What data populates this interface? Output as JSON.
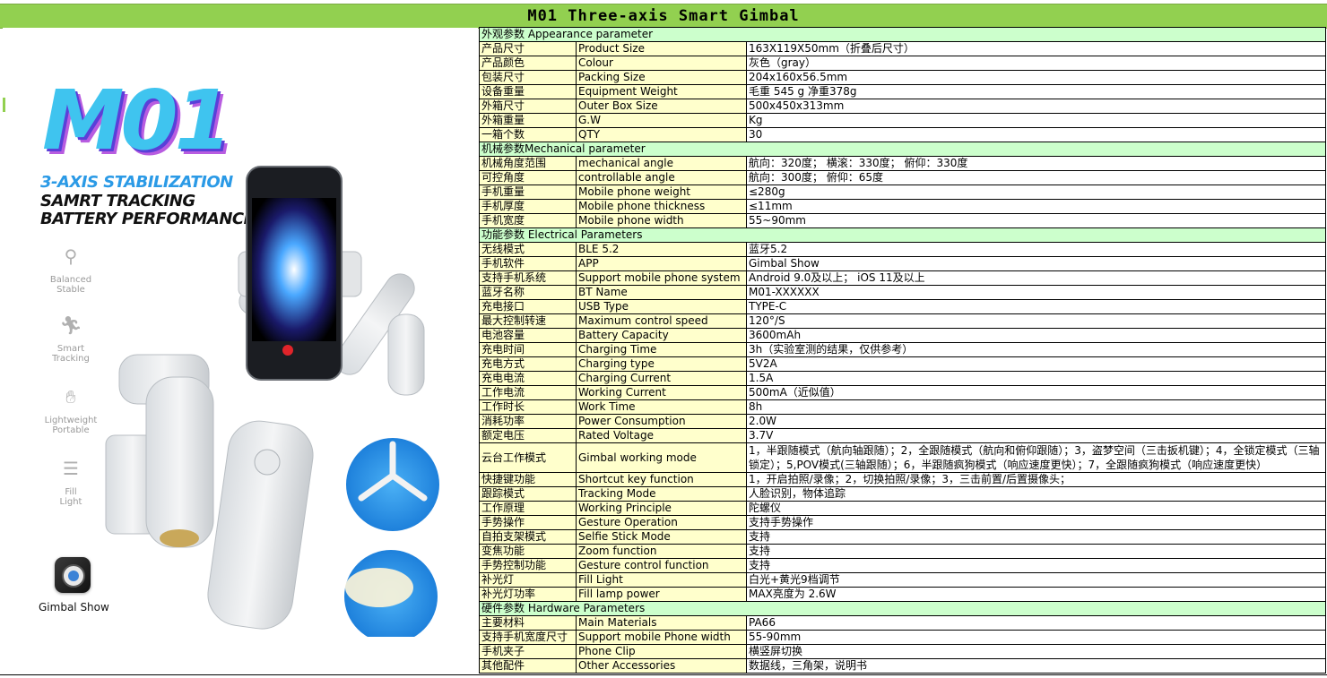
{
  "title": "M01 Three-axis Smart Gimbal",
  "promo": {
    "brand": "M01",
    "tagline1": "3-AXIS STABILIZATION",
    "tagline2": "SAMRT TRACKING",
    "tagline3": "BATTERY PERFORMANCE",
    "features": [
      {
        "label1": "Balanced",
        "label2": "Stable",
        "icon": "gimbal-icon"
      },
      {
        "label1": "Smart",
        "label2": "Tracking",
        "icon": "running-person-icon"
      },
      {
        "label1": "Lightweight",
        "label2": "Portable",
        "icon": "hand-icon"
      },
      {
        "label1": "Fill",
        "label2": "Light",
        "icon": "light-icon"
      }
    ],
    "app_name": "Gimbal Show"
  },
  "sections": [
    {
      "title": "外观参数  Appearance parameter",
      "rows": [
        {
          "cn": "产品尺寸",
          "en": "Product Size",
          "val": "163X119X50mm（折叠后尺寸）"
        },
        {
          "cn": "产品颜色",
          "en": "Colour",
          "val": "灰色（gray）"
        },
        {
          "cn": "包装尺寸",
          "en": "Packing Size",
          "val": "204x160x56.5mm"
        },
        {
          "cn": "设备重量",
          "en": "Equipment Weight",
          "val": "毛重 545 g  净重378g"
        },
        {
          "cn": "外箱尺寸",
          "en": "Outer Box Size",
          "val": "500x450x313mm"
        },
        {
          "cn": "外箱重量",
          "en": "G.W",
          "val": "Kg"
        },
        {
          "cn": "一箱个数",
          "en": "QTY",
          "val": "30"
        }
      ]
    },
    {
      "title": "机械参数Mechanical parameter",
      "rows": [
        {
          "cn": "机械角度范围",
          "en": "mechanical angle",
          "val": "航向：320度；   横滚：330度；  俯仰：330度"
        },
        {
          "cn": "可控角度",
          "en": "controllable angle",
          "val": "航向：300度；  俯仰：65度"
        },
        {
          "cn": "手机重量",
          "en": "Mobile phone weight",
          "val": "≤280g"
        },
        {
          "cn": "手机厚度",
          "en": "Mobile phone thickness",
          "val": "≤11mm"
        },
        {
          "cn": "手机宽度",
          "en": "Mobile phone width",
          "val": "55~90mm"
        }
      ]
    },
    {
      "title": "功能参数 Electrical Parameters",
      "rows": [
        {
          "cn": "无线模式",
          "en": "BLE 5.2",
          "val": "蓝牙5.2"
        },
        {
          "cn": "手机软件",
          "en": "APP",
          "val": "Gimbal Show"
        },
        {
          "cn": "支持手机系统",
          "en": "Support mobile phone system",
          "val": "Android 9.0及以上； iOS 11及以上"
        },
        {
          "cn": "蓝牙名称",
          "en": "BT Name",
          "val": "M01-XXXXXX"
        },
        {
          "cn": "充电接口",
          "en": "USB Type",
          "val": "TYPE-C"
        },
        {
          "cn": "最大控制转速",
          "en": "Maximum control speed",
          "val": "120°/S"
        },
        {
          "cn": "电池容量",
          "en": "Battery Capacity",
          "val": "3600mAh"
        },
        {
          "cn": "充电时间",
          "en": "Charging Time",
          "val": "3h（实验室测的结果，仅供参考）"
        },
        {
          "cn": "充电方式",
          "en": "Charging type",
          "val": "5V2A"
        },
        {
          "cn": "充电电流",
          "en": "Charging Current",
          "val": "1.5A"
        },
        {
          "cn": "工作电流",
          "en": "Working Current",
          "val": "500mA（近似值）"
        },
        {
          "cn": "工作时长",
          "en": "Work Time",
          "val": "8h"
        },
        {
          "cn": "消耗功率",
          "en": "Power Consumption",
          "val": "2.0W"
        },
        {
          "cn": "额定电压",
          "en": "Rated Voltage",
          "val": "3.7V"
        },
        {
          "cn": "云台工作模式",
          "en": "Gimbal working mode",
          "val": "1，半跟随模式（航向轴跟随）；2，全跟随模式（航向和俯仰跟随）；3，盗梦空间（三击扳机键）；4，全锁定模式（三轴锁定）；5,POV模式(三轴跟随）；6，半跟随疯狗模式（响应速度更快）；7，全跟随疯狗模式（响应速度更快）",
          "tall": true
        },
        {
          "cn": "快捷键功能",
          "en": "Shortcut key function",
          "val": "1，开启拍照/录像；2，切换拍照/录像；3，三击前置/后置摄像头；"
        },
        {
          "cn": "跟踪模式",
          "en": "Tracking Mode",
          "val": "人脸识别，物体追踪"
        },
        {
          "cn": "工作原理",
          "en": "Working Principle",
          "val": "陀螺仪"
        },
        {
          "cn": "手势操作",
          "en": "Gesture Operation",
          "val": "支持手势操作"
        },
        {
          "cn": "自拍支架模式",
          "en": "Selfie Stick Mode",
          "val": "支持"
        },
        {
          "cn": "变焦功能",
          "en": "Zoom function",
          "val": "支持"
        },
        {
          "cn": "手势控制功能",
          "en": "Gesture control function",
          "val": "支持"
        },
        {
          "cn": "补光灯",
          "en": "Fill Light",
          "val": "白光+黄光9档调节"
        },
        {
          "cn": "补光灯功率",
          "en": "Fill lamp power",
          "val": "MAX亮度为 2.6W"
        }
      ]
    },
    {
      "title": "硬件参数 Hardware Parameters",
      "rows": [
        {
          "cn": "主要材料",
          "en": "Main Materials",
          "val": "PA66"
        },
        {
          "cn": "支持手机宽度尺寸",
          "en": "Support mobile Phone width",
          "val": "55-90mm"
        },
        {
          "cn": "手机夹子",
          "en": "Phone Clip",
          "val": "横竖屏切换"
        },
        {
          "cn": "其他配件",
          "en": "Other Accessories",
          "val": "数据线，三角架，说明书"
        }
      ]
    }
  ]
}
